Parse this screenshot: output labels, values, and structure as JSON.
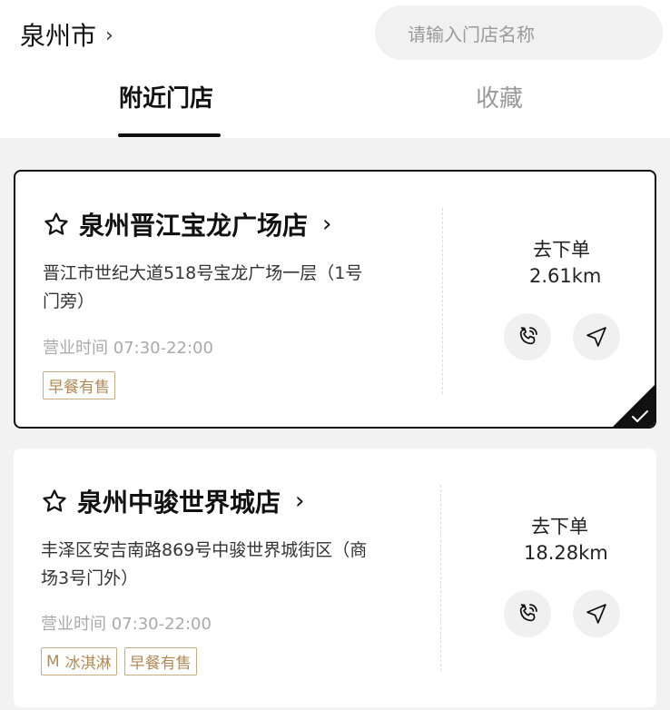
{
  "header": {
    "city": "泉州市",
    "city_chevron": "›",
    "search_placeholder": "请输入门店名称"
  },
  "tabs": [
    {
      "label": "附近门店",
      "active": true
    },
    {
      "label": "收藏",
      "active": false
    }
  ],
  "stores": [
    {
      "name": "泉州晋江宝龙广场店",
      "address": "晋江市世纪大道518号宝龙广场一层（1号门旁）",
      "hours": "营业时间 07:30-22:00",
      "tags": [
        "早餐有售"
      ],
      "order_label": "去下单",
      "distance": "2.61km",
      "selected": true
    },
    {
      "name": "泉州中骏世界城店",
      "address": "丰泽区安吉南路869号中骏世界城街区（商场3号门外）",
      "hours": "营业时间 07:30-22:00",
      "tags": [
        "冰淇淋",
        "早餐有售"
      ],
      "tag_icon": "Ⅿ",
      "order_label": "去下单",
      "distance": "18.28km",
      "selected": false
    }
  ],
  "icons": {
    "favorite": "star-outline-icon",
    "phone": "phone-icon",
    "navigate": "navigate-arrow-icon",
    "selected_check": "check-icon"
  },
  "colors": {
    "tag_gold": "#b08a54",
    "selected_border": "#111111"
  }
}
